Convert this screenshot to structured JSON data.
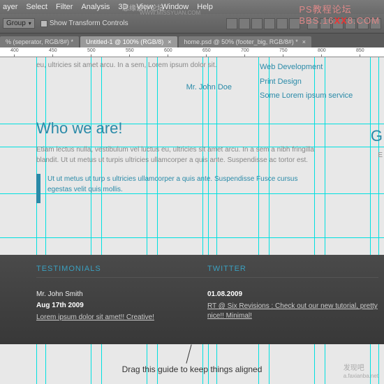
{
  "menu": {
    "items": [
      "ayer",
      "Select",
      "Filter",
      "Analysis",
      "3D",
      "View",
      "Window",
      "Help"
    ]
  },
  "options": {
    "group": "Group",
    "show_transform": "Show Transform Controls"
  },
  "tabs": [
    {
      "label": "% (seperator, RGB/8#) *"
    },
    {
      "label": "Untitled-1 @ 100% (RGB/8)"
    },
    {
      "label": "home.psd @ 50% (footer_big, RGB/8#) *"
    }
  ],
  "ruler": [
    "400",
    "450",
    "500",
    "550",
    "600",
    "650",
    "700",
    "750",
    "800",
    "850"
  ],
  "top_paragraph": "eu, ultricies sit amet arcu. In a sem,\nLorem ipsum dolor sit.",
  "author": "Mr. John Doe",
  "services": [
    "Web Development",
    "Print Design",
    "Some Lorem ipsum service"
  ],
  "who": {
    "heading": "Who we are!",
    "body": "Etiam lectus nulla, vestibulum vel luctus eu, ultricies sit amet arcu. In a sem a nibh fringilla blandit. Ut ut metus ut turpis ultricies ullamcorper a quis ante. Suspendisse ac tortor est.",
    "quote": "Ut ut metus ut turp s ultricies ullamcorper a quis ante. Suspendisse Fusce cursus egestas velit quis mollis."
  },
  "footer": {
    "testimonials": {
      "title": "TESTIMONIALS",
      "name": "Mr. John Smith",
      "date": "Aug 17th 2009",
      "body": "Lorem ipsum dolor sit amet!! Creative!"
    },
    "twitter": {
      "title": "TWITTER",
      "date": "01.08.2009",
      "body": "RT @ Six Revisions : Check out our new tutorial, pretty nice!! Minimal!"
    }
  },
  "annotation": "Drag this guide to keep things aligned",
  "watermarks": {
    "top1": "思缘设计论坛",
    "top1b": "WWW.MISSYUAN.COM",
    "top2a": "PS教程论坛",
    "top2b": "BBS.16",
    "top2c": "XX",
    "top2d": "8.COM",
    "bottom": "发现吧",
    "bottom2": "a.faxianba.net"
  },
  "cutoff": {
    "g": "G",
    "e": "E"
  }
}
